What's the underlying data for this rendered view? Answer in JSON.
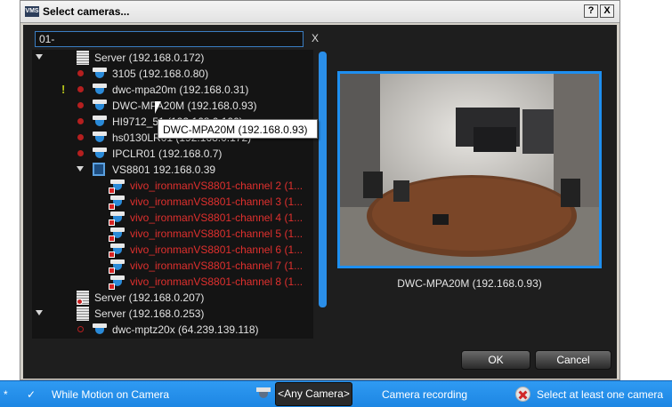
{
  "dialog": {
    "app_icon_text": "VMS",
    "title": "Select cameras...",
    "help_label": "?",
    "close_label": "X"
  },
  "search": {
    "value": "01-",
    "clear_label": "X"
  },
  "tree": {
    "items": [
      {
        "label": "Server (192.168.0.172)",
        "type": "server"
      },
      {
        "label": "3105 (192.168.0.80)",
        "type": "camera"
      },
      {
        "label": "dwc-mpa20m (192.168.0.31)",
        "type": "camera",
        "warning": "!"
      },
      {
        "label": "DWC-MPA20M (192.168.0.93)",
        "type": "camera"
      },
      {
        "label": "HI9712_51 (192.168.0.190)",
        "type": "camera"
      },
      {
        "label": "hs0130LR01 (192.168.0.172)",
        "type": "camera"
      },
      {
        "label": "IPCLR01 (192.168.0.7)",
        "type": "camera"
      },
      {
        "label": "VS8801 192.168.0.39",
        "type": "encoder"
      },
      {
        "label": "vivo_ironmanVS8801-channel 2 (1...",
        "type": "channel"
      },
      {
        "label": "vivo_ironmanVS8801-channel 3 (1...",
        "type": "channel"
      },
      {
        "label": "vivo_ironmanVS8801-channel 4 (1...",
        "type": "channel"
      },
      {
        "label": "vivo_ironmanVS8801-channel 5 (1...",
        "type": "channel"
      },
      {
        "label": "vivo_ironmanVS8801-channel 6 (1...",
        "type": "channel"
      },
      {
        "label": "vivo_ironmanVS8801-channel 7 (1...",
        "type": "channel"
      },
      {
        "label": "vivo_ironmanVS8801-channel 8 (1...",
        "type": "channel"
      },
      {
        "label": "Server (192.168.0.207)",
        "type": "server-offline"
      },
      {
        "label": "Server (192.168.0.253)",
        "type": "server"
      },
      {
        "label": "dwc-mptz20x (64.239.139.118)",
        "type": "camera"
      }
    ]
  },
  "tooltip": {
    "text": "DWC-MPA20M (192.168.0.93)"
  },
  "preview": {
    "label": "DWC-MPA20M (192.168.0.93)"
  },
  "buttons": {
    "ok": "OK",
    "cancel": "Cancel"
  },
  "rule_bar": {
    "marker": "*",
    "check": "✓",
    "event": "While Motion on Camera",
    "camera_selector": "<Any Camera>",
    "action": "Camera recording",
    "error": "Select at least one camera"
  },
  "colors": {
    "accent": "#1e8ff0",
    "tree_bg": "#141414",
    "error_text": "#e0302e",
    "rule_bar": "#2f9af2"
  }
}
